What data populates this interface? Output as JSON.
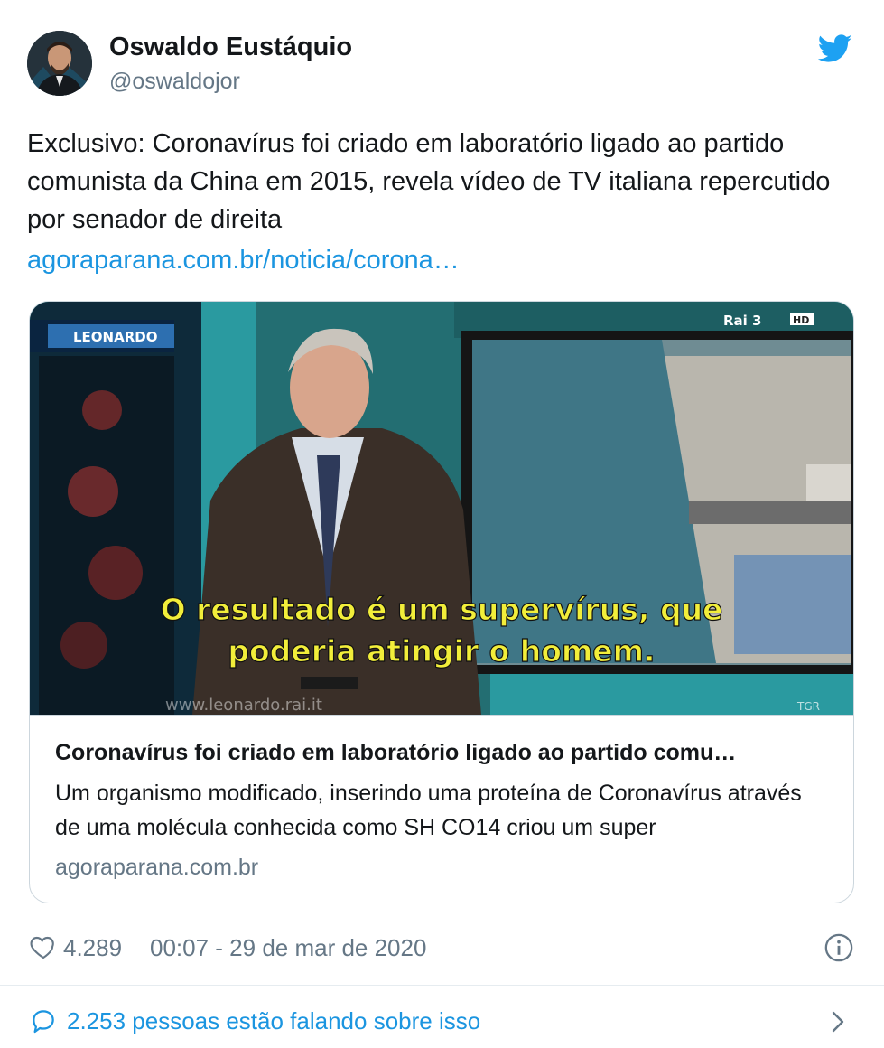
{
  "author": {
    "name": "Oswaldo Eustáquio",
    "handle": "@oswaldojor"
  },
  "tweet": {
    "text": "Exclusivo: Coronavírus foi criado em laboratório ligado ao partido comunista da China em 2015, revela vídeo de TV italiana repercutido por senador de direita",
    "link": "agoraparana.com.br/noticia/corona…"
  },
  "card": {
    "image": {
      "channel_logo_left": "LEONARDO",
      "channel_logo_right": "Rai 3",
      "hd_badge": "HD",
      "subtitle_line1": "O resultado é um supervírus, que",
      "subtitle_line2": "poderia atingir o homem.",
      "watermark": "www.leonardo.rai.it",
      "corner_tag": "TGR"
    },
    "title": "Coronavírus foi criado em laboratório ligado ao partido comu…",
    "description": "Um organismo modificado, inserindo uma proteína de Coronavírus através de uma molécula conhecida como SH CO14 criou um super",
    "domain": "agoraparana.com.br"
  },
  "footer": {
    "likes": "4.289",
    "timestamp": "00:07 - 29 de mar de 2020",
    "conversation": "2.253 pessoas estão falando sobre isso"
  },
  "colors": {
    "link_blue": "#1b95e0",
    "twitter_blue": "#1da1f2",
    "secondary_text": "#657786",
    "subtitle_yellow": "#f2ee3a"
  },
  "icons": {
    "bird": "twitter-bird-icon",
    "heart": "heart-icon",
    "info": "info-icon",
    "talk": "speech-bubble-icon",
    "chevron": "chevron-right-icon"
  }
}
